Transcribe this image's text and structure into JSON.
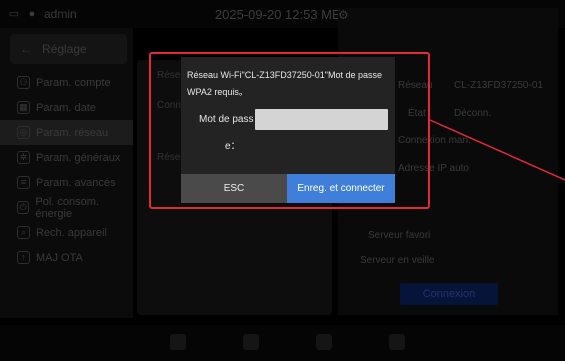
{
  "status_bar": {
    "user": "admin",
    "clock": "2025-09-20 12:53 MER"
  },
  "sidebar": {
    "back_label": "Réglage",
    "items": [
      {
        "label": "Param. compte",
        "icon": "user-icon"
      },
      {
        "label": "Param. date",
        "icon": "calendar-icon"
      },
      {
        "label": "Param. réseau",
        "icon": "network-icon"
      },
      {
        "label": "Param. généraux",
        "icon": "gear-icon"
      },
      {
        "label": "Param. avancés",
        "icon": "sliders-icon"
      },
      {
        "label": "Pol. consom. énergie",
        "icon": "power-icon"
      },
      {
        "label": "Rech. appareil",
        "icon": "search-device-icon"
      },
      {
        "label": "MAJ OTA",
        "icon": "update-icon"
      }
    ]
  },
  "network_panel": {
    "col1": [
      "Réseau",
      "Conn",
      "Réseau"
    ],
    "network_label": "Réseau",
    "network_value": "CL-Z13FD37250-01",
    "state_label": "État",
    "state_value": "Déconn.",
    "manual_label": "Connexion man.",
    "ip_label": "Adresse IP auto",
    "dns_label": "Serveur favori",
    "dns2_label": "Serveur en veille",
    "connect_label": "Connexion"
  },
  "modal": {
    "message": "Réseau Wi-Fi\"CL-Z13FD37250-01\"Mot de passe WPA2 requis。",
    "field_label_line1": "Mot de pass",
    "field_label_line2": "e：",
    "password_value": "",
    "esc_label": "ESC",
    "save_label": "Enreg. et connecter"
  },
  "colors": {
    "highlight": "#e0293a",
    "primary_button": "#3f7fd9",
    "modal_bg": "#232323"
  }
}
